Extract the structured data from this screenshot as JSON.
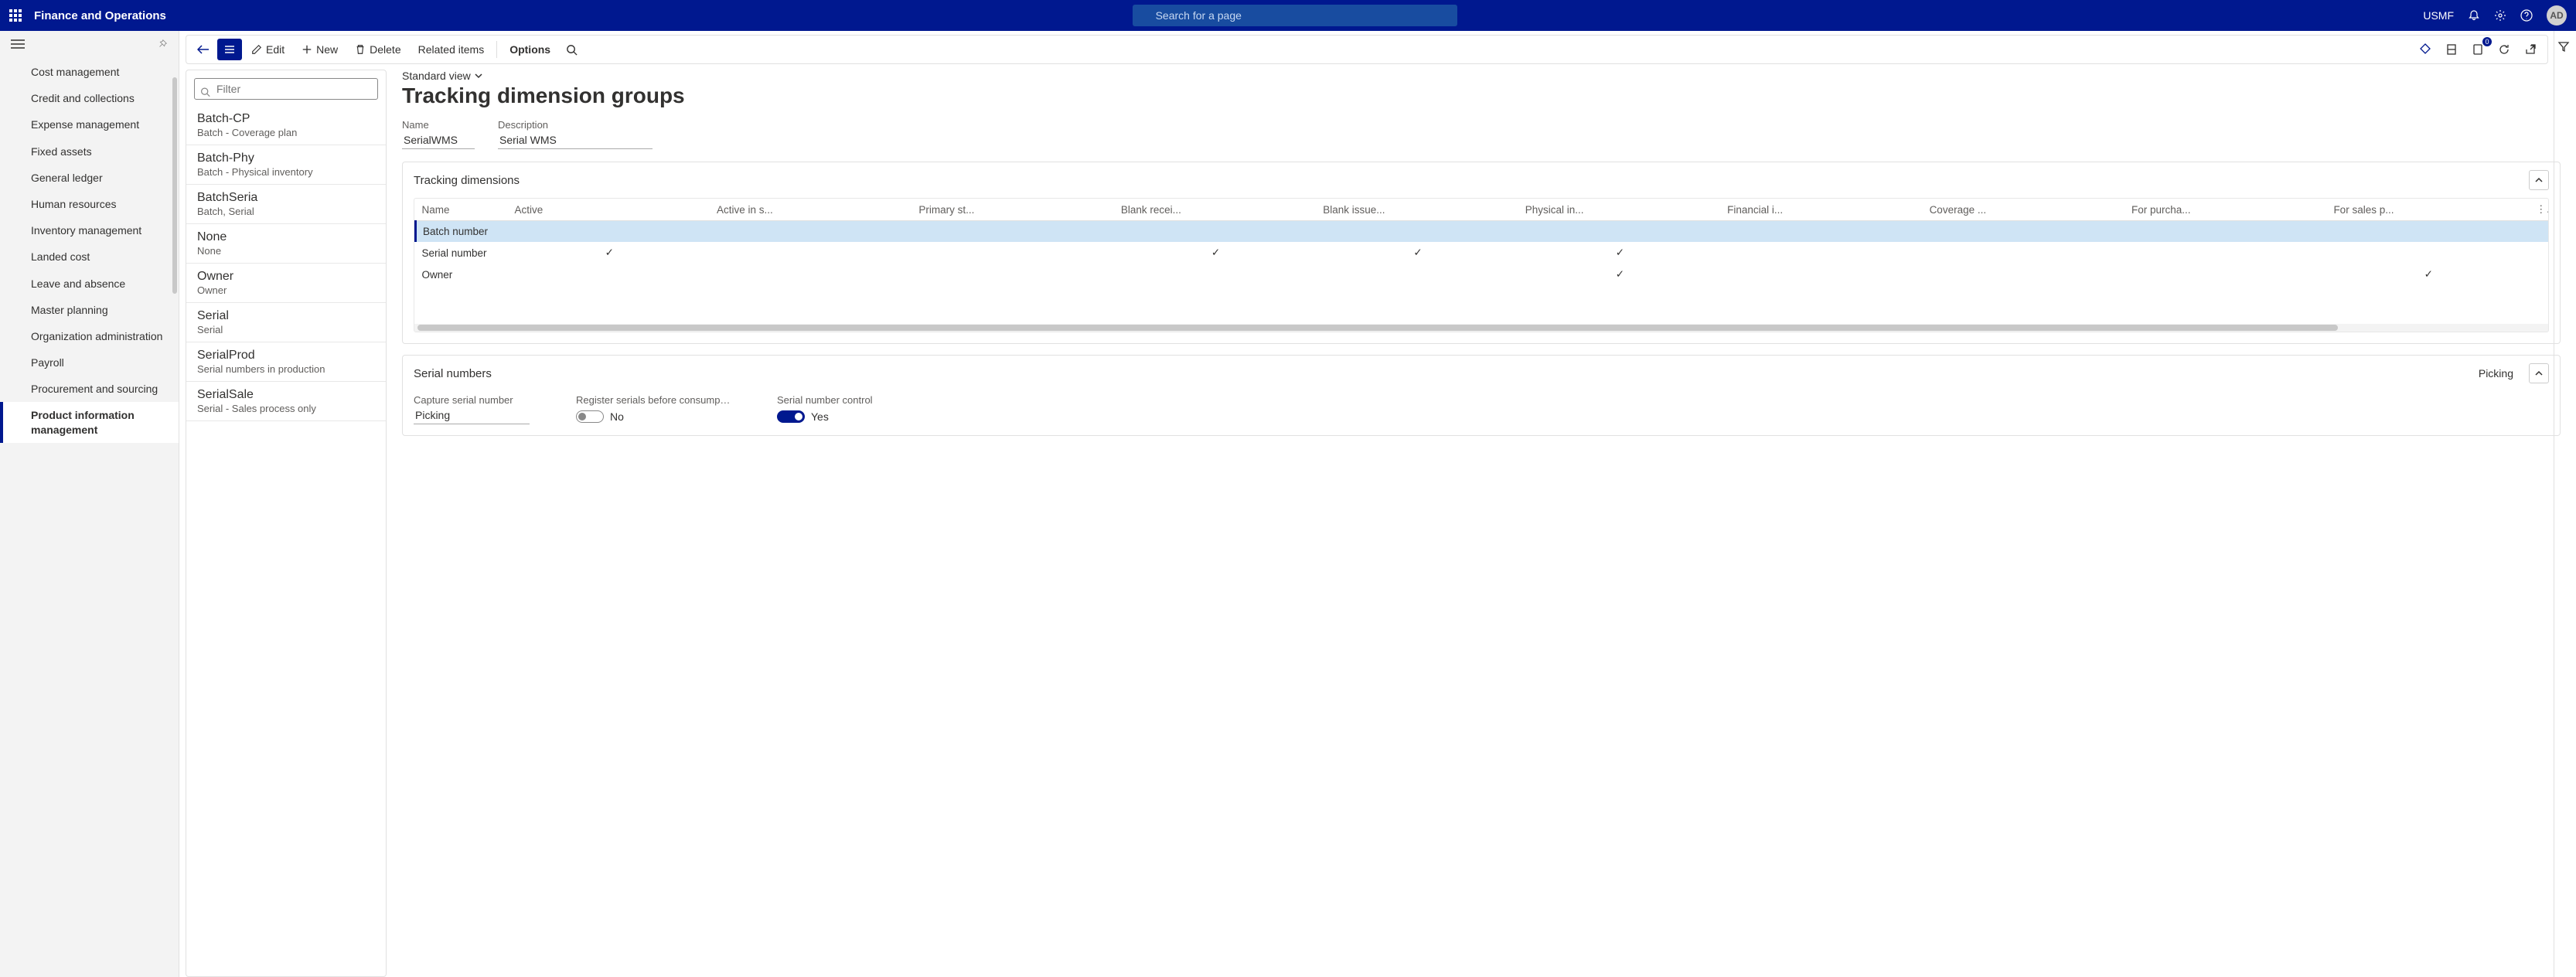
{
  "header": {
    "app_title": "Finance and Operations",
    "search_placeholder": "Search for a page",
    "company": "USMF",
    "avatar_initials": "AD"
  },
  "nav": {
    "items": [
      "Cost management",
      "Credit and collections",
      "Expense management",
      "Fixed assets",
      "General ledger",
      "Human resources",
      "Inventory management",
      "Landed cost",
      "Leave and absence",
      "Master planning",
      "Organization administration",
      "Payroll",
      "Procurement and sourcing",
      "Product information management"
    ],
    "active_index": 13
  },
  "toolbar": {
    "edit": "Edit",
    "new": "New",
    "delete": "Delete",
    "related_items": "Related items",
    "options": "Options"
  },
  "list": {
    "filter_placeholder": "Filter",
    "items": [
      {
        "title": "Batch-CP",
        "sub": "Batch - Coverage plan"
      },
      {
        "title": "Batch-Phy",
        "sub": "Batch - Physical inventory"
      },
      {
        "title": "BatchSeria",
        "sub": "Batch, Serial"
      },
      {
        "title": "None",
        "sub": "None"
      },
      {
        "title": "Owner",
        "sub": "Owner"
      },
      {
        "title": "Serial",
        "sub": "Serial"
      },
      {
        "title": "SerialProd",
        "sub": "Serial numbers in production"
      },
      {
        "title": "SerialSale",
        "sub": "Serial - Sales process only"
      }
    ]
  },
  "detail": {
    "view_name": "Standard view",
    "page_title": "Tracking dimension groups",
    "name_label": "Name",
    "name_value": "SerialWMS",
    "description_label": "Description",
    "description_value": "Serial WMS"
  },
  "tracking_card": {
    "title": "Tracking dimensions",
    "columns": [
      "Name",
      "Active",
      "Active in s...",
      "Primary st...",
      "Blank recei...",
      "Blank issue...",
      "Physical in...",
      "Financial i...",
      "Coverage ...",
      "For purcha...",
      "For sales p..."
    ],
    "rows": [
      {
        "name": "Batch number",
        "checks": [
          "",
          "",
          "",
          "",
          "",
          "",
          "",
          "",
          "",
          ""
        ],
        "selected": true
      },
      {
        "name": "Serial number",
        "checks": [
          "✓",
          "",
          "",
          "✓",
          "✓",
          "✓",
          "",
          "",
          "",
          ""
        ],
        "selected": false
      },
      {
        "name": "Owner",
        "checks": [
          "",
          "",
          "",
          "",
          "",
          "✓",
          "",
          "",
          "",
          "✓"
        ],
        "selected": false
      }
    ]
  },
  "serial_card": {
    "title": "Serial numbers",
    "header_extra": "Picking",
    "capture_label": "Capture serial number",
    "capture_value": "Picking",
    "register_label": "Register serials before consumpti...",
    "register_value": "No",
    "control_label": "Serial number control",
    "control_value": "Yes"
  }
}
